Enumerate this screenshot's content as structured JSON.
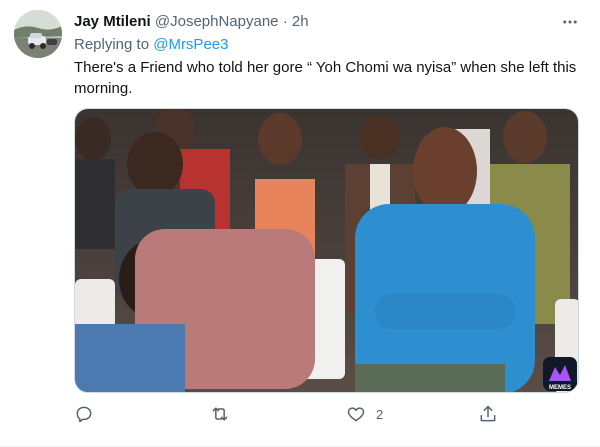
{
  "tweet": {
    "author_name": "Jay Mtileni",
    "author_handle": "@JosephNapyane",
    "separator": "·",
    "time": "2h",
    "replying_prefix": "Replying to",
    "replying_to": "@MrsPee3",
    "text": "There's a Friend who told her gore “ Yoh Chomi wa nyisa” when she left this morning.",
    "media": {
      "description_icon": "photo",
      "watermark": "MEMES"
    }
  },
  "actions": {
    "reply_count": "",
    "retweet_count": "",
    "like_count": "2",
    "share_count": ""
  },
  "colors": {
    "accent": "#1d9bf0",
    "secondary_text": "#536471",
    "primary_text": "#0f1419",
    "border": "#cfd9de"
  },
  "icons": [
    "more-icon",
    "reply-icon",
    "retweet-icon",
    "like-icon",
    "share-icon"
  ]
}
